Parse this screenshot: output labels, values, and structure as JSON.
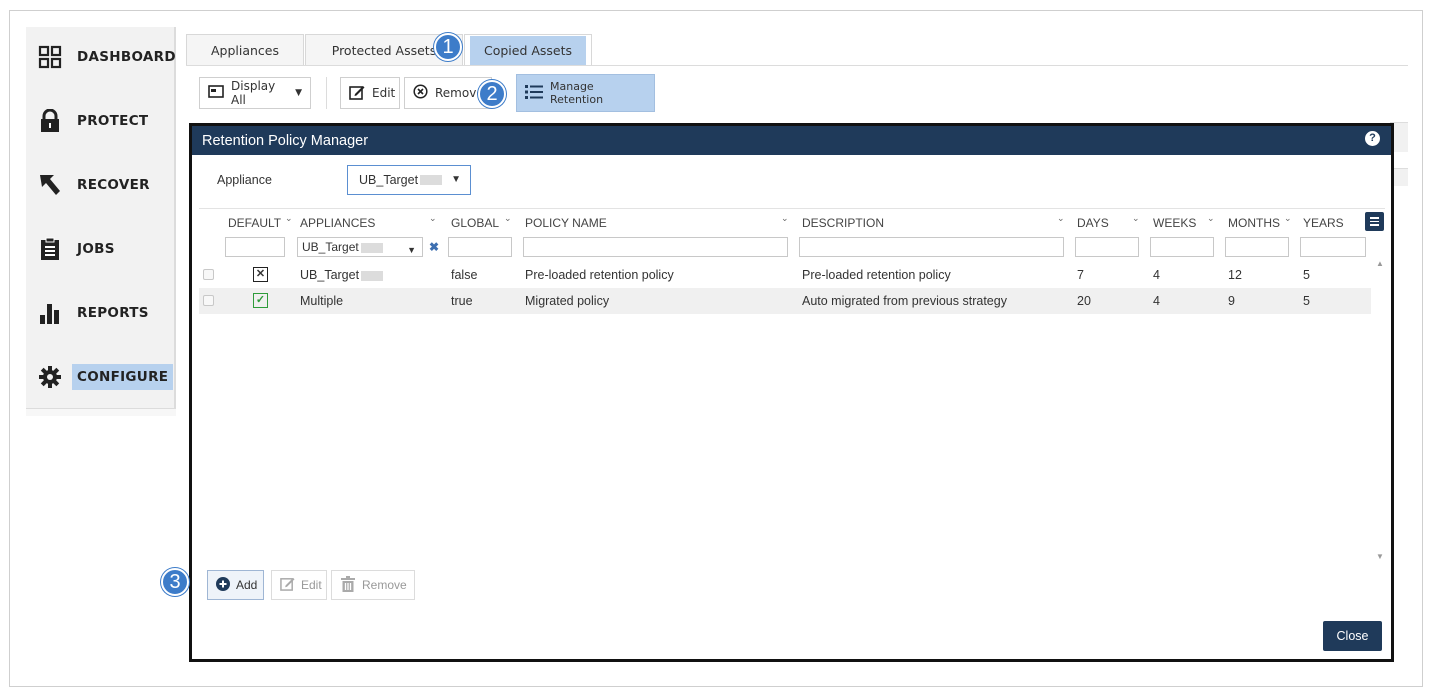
{
  "sidebar": {
    "items": [
      {
        "label": "DASHBOARD",
        "icon": "grid-icon"
      },
      {
        "label": "PROTECT",
        "icon": "lock-icon"
      },
      {
        "label": "RECOVER",
        "icon": "arrow-icon"
      },
      {
        "label": "JOBS",
        "icon": "clipboard-icon"
      },
      {
        "label": "REPORTS",
        "icon": "bar-chart-icon"
      },
      {
        "label": "CONFIGURE",
        "icon": "gear-icon",
        "active": true
      }
    ]
  },
  "tabs": [
    {
      "label": "Appliances"
    },
    {
      "label": "Protected Assets"
    },
    {
      "label": "Copied Assets",
      "active": true
    }
  ],
  "toolbar": {
    "display_all": "Display All",
    "edit": "Edit",
    "remove": "Remove",
    "manage_retention": "Manage Retention"
  },
  "callouts": [
    "1",
    "2",
    "3"
  ],
  "dialog": {
    "title": "Retention Policy Manager",
    "help": "?",
    "appliance_label": "Appliance",
    "appliance_value": "UB_Target",
    "columns": [
      "DEFAULT",
      "APPLIANCES",
      "GLOBAL",
      "POLICY NAME",
      "DESCRIPTION",
      "DAYS",
      "WEEKS",
      "MONTHS",
      "YEARS"
    ],
    "appliance_filter": "UB_Target",
    "rows": [
      {
        "default": false,
        "appliance": "UB_Target",
        "global": "false",
        "policy_name": "Pre-loaded retention policy",
        "description": "Pre-loaded retention policy",
        "days": "7",
        "weeks": "4",
        "months": "12",
        "years": "5"
      },
      {
        "default": true,
        "appliance": "Multiple",
        "global": "true",
        "policy_name": "Migrated policy",
        "description": "Auto migrated from previous strategy",
        "days": "20",
        "weeks": "4",
        "months": "9",
        "years": "5"
      }
    ],
    "buttons": {
      "add": "Add",
      "edit": "Edit",
      "remove": "Remove",
      "close": "Close"
    }
  },
  "colors": {
    "accent": "#b7d1ee",
    "header": "#1f3a5a",
    "callout": "#3d7cc9",
    "ok": "#2e9c3a"
  }
}
